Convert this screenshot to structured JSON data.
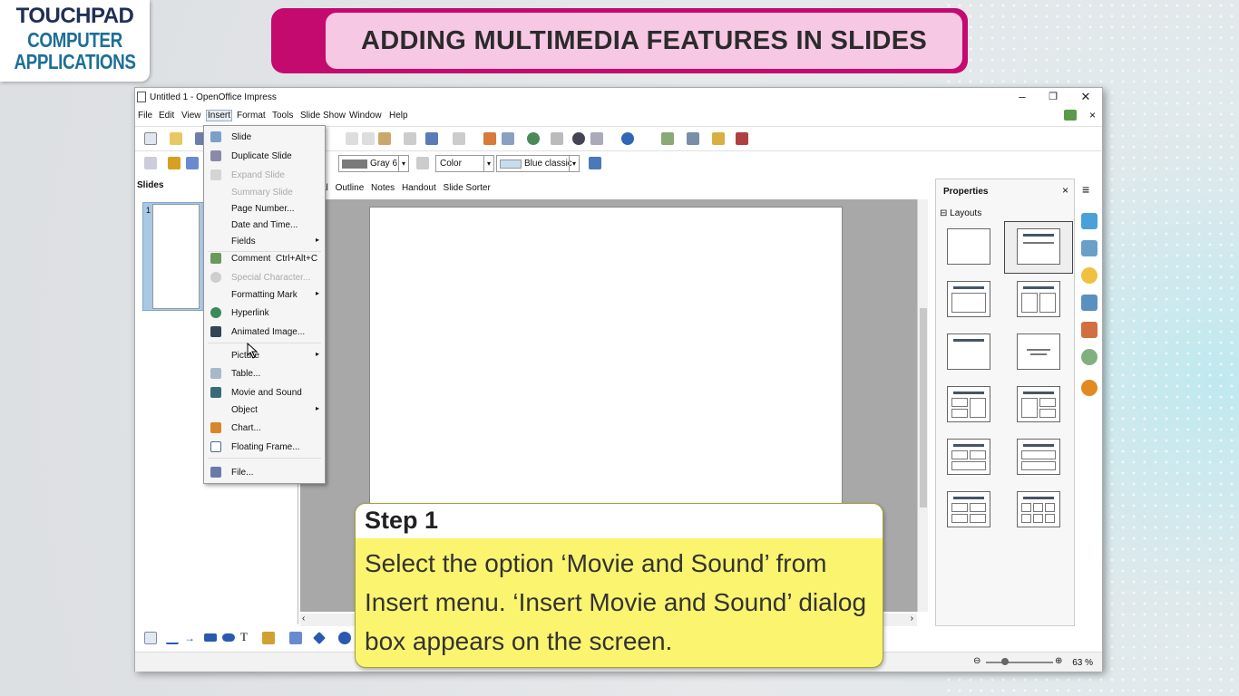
{
  "logo": {
    "brand": "TOUCHPAD",
    "line1": "COMPUTER",
    "line2": "APPLICATIONS"
  },
  "banner": {
    "title": "ADDING MULTIMEDIA FEATURES IN SLIDES"
  },
  "window": {
    "title": "Untitled 1 - OpenOffice Impress",
    "minimize": "–",
    "maximize": "❐",
    "close": "✕"
  },
  "menubar": [
    "File",
    "Edit",
    "View",
    "Insert",
    "Format",
    "Tools",
    "Slide Show",
    "Window",
    "Help"
  ],
  "toolbar2": {
    "line_color": "Gray 6",
    "area_style": "Color",
    "area_fill": "Blue classic"
  },
  "slides_pane": {
    "header": "Slides",
    "slide_number": "1"
  },
  "view_tabs": [
    "al",
    "Outline",
    "Notes",
    "Handout",
    "Slide Sorter"
  ],
  "properties": {
    "header": "Properties",
    "close": "×",
    "section": "Layouts",
    "section_toggle": "⊟"
  },
  "insert_menu": [
    {
      "label": "Slide",
      "shortcut": "",
      "submenu": false,
      "disabled": false,
      "icon": "slide-icon"
    },
    {
      "label": "Duplicate Slide",
      "shortcut": "",
      "submenu": false,
      "disabled": false,
      "icon": "duplicate-slide-icon"
    },
    {
      "label": "Expand Slide",
      "shortcut": "",
      "submenu": false,
      "disabled": true,
      "icon": "expand-slide-icon"
    },
    {
      "label": "Summary Slide",
      "shortcut": "",
      "submenu": false,
      "disabled": true,
      "icon": ""
    },
    {
      "label": "Page Number...",
      "shortcut": "",
      "submenu": false,
      "disabled": false,
      "icon": ""
    },
    {
      "label": "Date and Time...",
      "shortcut": "",
      "submenu": false,
      "disabled": false,
      "icon": ""
    },
    {
      "label": "Fields",
      "shortcut": "",
      "submenu": true,
      "disabled": false,
      "icon": ""
    },
    {
      "label": "Comment",
      "shortcut": "Ctrl+Alt+C",
      "submenu": false,
      "disabled": false,
      "icon": "comment-icon"
    },
    {
      "label": "Special Character...",
      "shortcut": "",
      "submenu": false,
      "disabled": true,
      "icon": "special-character-icon"
    },
    {
      "label": "Formatting Mark",
      "shortcut": "",
      "submenu": true,
      "disabled": false,
      "icon": ""
    },
    {
      "label": "Hyperlink",
      "shortcut": "",
      "submenu": false,
      "disabled": false,
      "icon": "hyperlink-icon"
    },
    {
      "label": "Animated Image...",
      "shortcut": "",
      "submenu": false,
      "disabled": false,
      "icon": "animated-image-icon"
    },
    {
      "label": "Picture",
      "shortcut": "",
      "submenu": true,
      "disabled": false,
      "icon": ""
    },
    {
      "label": "Table...",
      "shortcut": "",
      "submenu": false,
      "disabled": false,
      "icon": "table-icon"
    },
    {
      "label": "Movie and Sound",
      "shortcut": "",
      "submenu": false,
      "disabled": false,
      "icon": "movie-and-sound-icon"
    },
    {
      "label": "Object",
      "shortcut": "",
      "submenu": true,
      "disabled": false,
      "icon": ""
    },
    {
      "label": "Chart...",
      "shortcut": "",
      "submenu": false,
      "disabled": false,
      "icon": "chart-icon"
    },
    {
      "label": "Floating Frame...",
      "shortcut": "",
      "submenu": false,
      "disabled": false,
      "icon": "floating-frame-icon"
    },
    {
      "label": "File...",
      "shortcut": "",
      "submenu": false,
      "disabled": false,
      "icon": "file-icon"
    }
  ],
  "status": {
    "zoom": "63 %"
  },
  "step": {
    "title": "Step 1",
    "text": "Select the option ‘Movie and Sound’ from Insert menu. ‘Insert Movie and Sound’ dialog box appears on the screen."
  }
}
